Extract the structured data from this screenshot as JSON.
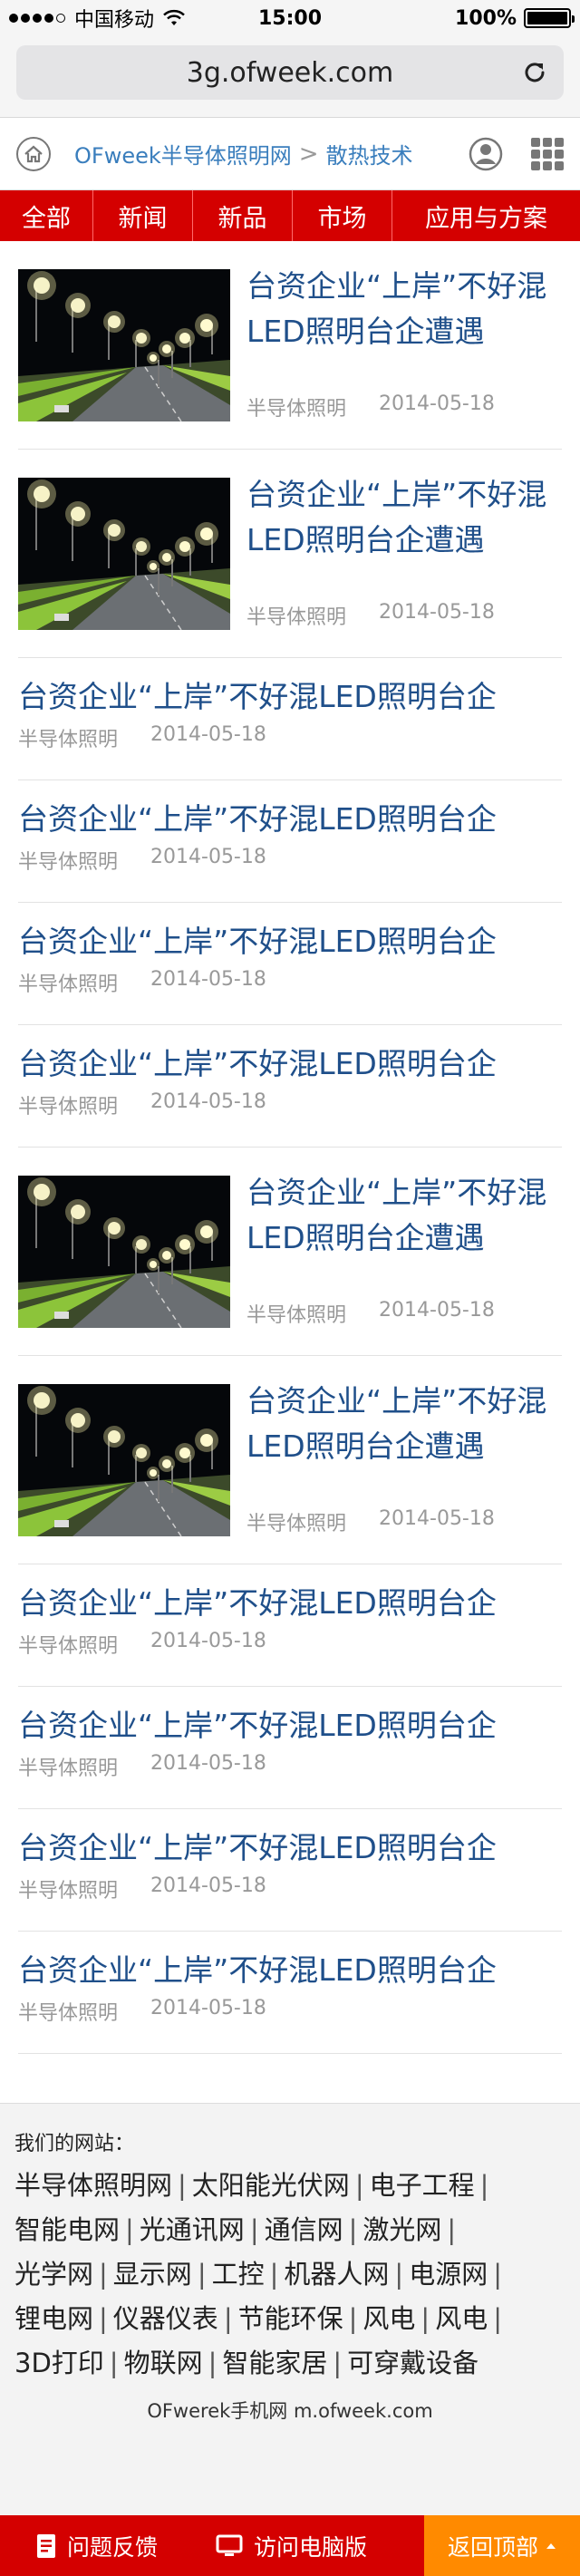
{
  "status_bar": {
    "carrier": "中国移动",
    "time": "15:00",
    "battery": "100%",
    "battery_level": 1.0
  },
  "url_bar": {
    "url": "3g.ofweek.com"
  },
  "header": {
    "site_name": "OFweek半导体照明网",
    "separator": ">",
    "section": "散热技术"
  },
  "nav": {
    "tabs": [
      {
        "label": "全部"
      },
      {
        "label": "新闻"
      },
      {
        "label": "新品"
      },
      {
        "label": "市场"
      },
      {
        "label": "应用与方案"
      }
    ]
  },
  "articles": [
    {
      "type": "image",
      "title": "台资企业“上岸”不好混LED照明台企遭遇",
      "category": "半导体照明",
      "date": "2014-05-18"
    },
    {
      "type": "image",
      "title": "台资企业“上岸”不好混LED照明台企遭遇",
      "category": "半导体照明",
      "date": "2014-05-18"
    },
    {
      "type": "text",
      "title": "台资企业“上岸”不好混LED照明台企",
      "category": "半导体照明",
      "date": "2014-05-18"
    },
    {
      "type": "text",
      "title": "台资企业“上岸”不好混LED照明台企",
      "category": "半导体照明",
      "date": "2014-05-18"
    },
    {
      "type": "text",
      "title": "台资企业“上岸”不好混LED照明台企",
      "category": "半导体照明",
      "date": "2014-05-18"
    },
    {
      "type": "text",
      "title": "台资企业“上岸”不好混LED照明台企",
      "category": "半导体照明",
      "date": "2014-05-18"
    },
    {
      "type": "image",
      "title": "台资企业“上岸”不好混LED照明台企遭遇",
      "category": "半导体照明",
      "date": "2014-05-18"
    },
    {
      "type": "image",
      "title": "台资企业“上岸”不好混LED照明台企遭遇",
      "category": "半导体照明",
      "date": "2014-05-18"
    },
    {
      "type": "text",
      "title": "台资企业“上岸”不好混LED照明台企",
      "category": "半导体照明",
      "date": "2014-05-18"
    },
    {
      "type": "text",
      "title": "台资企业“上岸”不好混LED照明台企",
      "category": "半导体照明",
      "date": "2014-05-18"
    },
    {
      "type": "text",
      "title": "台资企业“上岸”不好混LED照明台企",
      "category": "半导体照明",
      "date": "2014-05-18"
    },
    {
      "type": "text",
      "title": "台资企业“上岸”不好混LED照明台企",
      "category": "半导体照明",
      "date": "2014-05-18"
    }
  ],
  "footer": {
    "label": "我们的网站：",
    "sites": [
      "半导体照明网",
      "太阳能光伏网",
      "电子工程",
      "智能电网",
      "光通讯网",
      "通信网",
      "激光网",
      "光学网",
      "显示网",
      "工控",
      "机器人网",
      "电源网",
      "锂电网",
      "仪器仪表",
      "节能环保",
      "风电",
      "风电",
      "3D打印",
      "物联网",
      "智能家居",
      "可穿戴设备"
    ],
    "mobile_text": "OFwerek手机网 m.ofweek.com"
  },
  "bottom_bar": {
    "feedback": "问题反馈",
    "desktop": "访问电脑版",
    "top": "返回顶部"
  },
  "colors": {
    "accent_red": "#d40000",
    "accent_orange": "#ff8a00",
    "title_blue": "#1f4f8a",
    "link_blue": "#3a7ebd"
  }
}
